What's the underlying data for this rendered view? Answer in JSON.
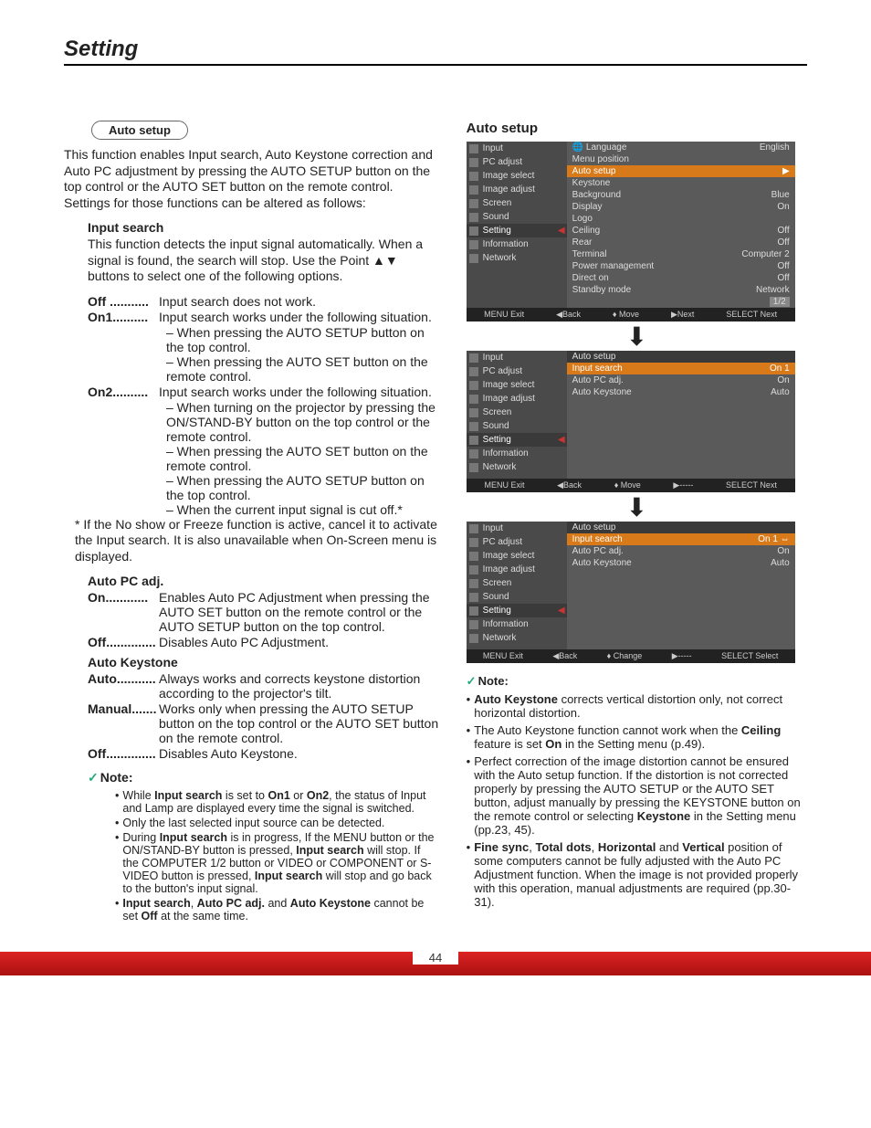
{
  "page": {
    "header": "Setting",
    "number": "44"
  },
  "left": {
    "pill": "Auto setup",
    "intro": "This function enables Input search, Auto Keystone correction and Auto PC adjustment by pressing the AUTO SETUP button on the top control or the AUTO SET button on the remote control. Settings for those functions can be altered as follows:",
    "input_search": {
      "title": "Input search",
      "desc": "This function detects the input signal automatically. When a signal is found, the search will stop. Use the Point ▲▼ buttons to select one of the following options.",
      "rows": [
        {
          "label": "Off",
          "dots": " ........... ",
          "body": "Input search does not work."
        },
        {
          "label": "On1",
          "dots": ".......... ",
          "body": "Input search works under the following situation."
        }
      ],
      "on1_subs": [
        "– When pressing the AUTO SETUP button on the top control.",
        "– When pressing the AUTO SET button on the remote control."
      ],
      "row_on2": {
        "label": "On2",
        "dots": ".......... ",
        "body": "Input search works under the following situation."
      },
      "on2_subs": [
        "– When turning on the projector by pressing the ON/STAND-BY button on the top control or the remote control.",
        "– When pressing the AUTO SET button on the remote control.",
        "– When pressing the AUTO SETUP button on the top control.",
        "–  When the current input signal is cut off.*"
      ],
      "footnote": "* If the No show or Freeze function is active, cancel it to activate the Input search. It is also unavailable when On-Screen menu is displayed."
    },
    "auto_pc": {
      "title": "Auto PC adj.",
      "rows": [
        {
          "label": "On",
          "dots": "............ ",
          "body": "Enables Auto PC Adjustment when pressing the AUTO SET button on the remote control or the AUTO SETUP button on the top control."
        },
        {
          "label": "Off",
          "dots": ".............. ",
          "body": "Disables Auto PC Adjustment."
        }
      ]
    },
    "auto_keystone": {
      "title": "Auto Keystone",
      "rows": [
        {
          "label": "Auto",
          "dots": "........... ",
          "body": "Always works and corrects keystone distortion according to the projector's tilt."
        },
        {
          "label": "Manual",
          "dots": "....... ",
          "body": "Works only when pressing the AUTO SETUP button on the top control or the AUTO SET button on the remote control."
        },
        {
          "label": "Off",
          "dots": ".............. ",
          "body": "Disables Auto Keystone."
        }
      ]
    },
    "note": {
      "label": "Note:",
      "items": [
        "While <b>Input search</b> is set to <b>On1</b> or <b>On2</b>, the status of Input and Lamp are displayed every time the signal is switched.",
        "Only the last selected input source can be detected.",
        "During <b>Input search</b> is in progress, If the MENU button or the ON/STAND-BY button is pressed, <b>Input search</b> will stop. If the COMPUTER 1/2 button or VIDEO or COMPONENT or S-VIDEO button is pressed, <b>Input search</b> will stop and go back to the button's input signal.",
        "<b>Input search</b>, <b>Auto PC adj.</b> and <b>Auto Keystone</b> cannot be set <b>Off</b> at the same time."
      ]
    }
  },
  "right": {
    "title": "Auto setup",
    "osd1": {
      "side": [
        "Input",
        "PC adjust",
        "Image select",
        "Image adjust",
        "Screen",
        "Sound",
        "Setting",
        "Information",
        "Network"
      ],
      "main": [
        {
          "l": "Language",
          "r": "English",
          "globe": true
        },
        {
          "l": "Menu position",
          "r": ""
        },
        {
          "l": "Auto setup",
          "r": "▶",
          "hl": true
        },
        {
          "l": "Keystone",
          "r": ""
        },
        {
          "l": "Background",
          "r": "Blue"
        },
        {
          "l": "Display",
          "r": "On"
        },
        {
          "l": "Logo",
          "r": ""
        },
        {
          "l": "Ceiling",
          "r": "Off"
        },
        {
          "l": "Rear",
          "r": "Off"
        },
        {
          "l": "Terminal",
          "r": "Computer 2"
        },
        {
          "l": "Power management",
          "r": "Off"
        },
        {
          "l": "Direct on",
          "r": "Off"
        },
        {
          "l": "Standby mode",
          "r": "Network"
        }
      ],
      "foot": [
        "MENU Exit",
        "◀Back",
        "♦ Move",
        "▶Next",
        "SELECT Next"
      ],
      "page": "1/2"
    },
    "osd2": {
      "side": [
        "Input",
        "PC adjust",
        "Image select",
        "Image adjust",
        "Screen",
        "Sound",
        "Setting",
        "Information",
        "Network"
      ],
      "main_title": {
        "l": "Auto setup",
        "r": ""
      },
      "main": [
        {
          "l": "Input search",
          "r": "On 1",
          "hl": true
        },
        {
          "l": "Auto PC adj.",
          "r": "On"
        },
        {
          "l": "Auto Keystone",
          "r": "Auto"
        }
      ],
      "foot": [
        "MENU Exit",
        "◀Back",
        "♦ Move",
        "▶-----",
        "SELECT Next"
      ]
    },
    "osd3": {
      "side": [
        "Input",
        "PC adjust",
        "Image select",
        "Image adjust",
        "Screen",
        "Sound",
        "Setting",
        "Information",
        "Network"
      ],
      "main_title": {
        "l": "Auto setup",
        "r": ""
      },
      "main": [
        {
          "l": "Input search",
          "r": "On 1 ⇔",
          "hl": true
        },
        {
          "l": "Auto PC adj.",
          "r": "On"
        },
        {
          "l": "Auto Keystone",
          "r": "Auto"
        }
      ],
      "foot": [
        "MENU Exit",
        "◀Back",
        "♦ Change",
        "▶-----",
        "SELECT Select"
      ]
    },
    "note": {
      "label": "Note:",
      "items": [
        "<b>Auto Keystone</b> corrects vertical distortion only, not correct horizontal distortion.",
        "The Auto Keystone function cannot work when the <b>Ceiling</b> feature is set <b>On</b> in the Setting menu (p.49).",
        "Perfect correction of the image distortion cannot be ensured with the Auto setup function. If the distortion is not corrected properly by pressing the AUTO SETUP or the AUTO SET button, adjust manually by pressing the KEYSTONE button on the remote control or selecting <b>Keystone</b> in the Setting menu (pp.23, 45).",
        "<b>Fine sync</b>, <b>Total dots</b>, <b>Horizontal</b> and <b>Vertical</b> position of some computers cannot be fully adjusted with the Auto PC Adjustment function. When the image is not provided properly with this operation, manual adjustments are required (pp.30-31)."
      ]
    }
  }
}
